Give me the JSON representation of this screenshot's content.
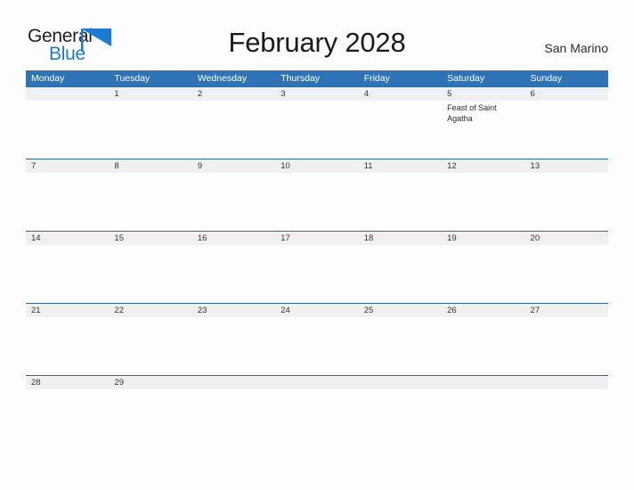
{
  "brand": {
    "name_part1": "General",
    "name_part2": "Blue",
    "flag_icon": "blue-flag-triangle",
    "color_dark": "#231f20",
    "color_blue": "#1b7ad1"
  },
  "header": {
    "title": "February 2028",
    "locale": "San Marino"
  },
  "theme": {
    "header_blue": "#2e73b5",
    "row_line_blue": "#2e6da4",
    "daynum_band_gray": "#f0f0f0",
    "page_background": "#fdfdfd"
  },
  "calendar": {
    "month": "February",
    "year": "2028",
    "weekday_headers": [
      "Monday",
      "Tuesday",
      "Wednesday",
      "Thursday",
      "Friday",
      "Saturday",
      "Sunday"
    ],
    "weeks": [
      {
        "days": [
          {
            "num": "",
            "event": ""
          },
          {
            "num": "1",
            "event": ""
          },
          {
            "num": "2",
            "event": ""
          },
          {
            "num": "3",
            "event": ""
          },
          {
            "num": "4",
            "event": ""
          },
          {
            "num": "5",
            "event": "Feast of Saint Agatha"
          },
          {
            "num": "6",
            "event": ""
          }
        ]
      },
      {
        "days": [
          {
            "num": "7",
            "event": ""
          },
          {
            "num": "8",
            "event": ""
          },
          {
            "num": "9",
            "event": ""
          },
          {
            "num": "10",
            "event": ""
          },
          {
            "num": "11",
            "event": ""
          },
          {
            "num": "12",
            "event": ""
          },
          {
            "num": "13",
            "event": ""
          }
        ]
      },
      {
        "days": [
          {
            "num": "14",
            "event": ""
          },
          {
            "num": "15",
            "event": ""
          },
          {
            "num": "16",
            "event": ""
          },
          {
            "num": "17",
            "event": ""
          },
          {
            "num": "18",
            "event": ""
          },
          {
            "num": "19",
            "event": ""
          },
          {
            "num": "20",
            "event": ""
          }
        ]
      },
      {
        "days": [
          {
            "num": "21",
            "event": ""
          },
          {
            "num": "22",
            "event": ""
          },
          {
            "num": "23",
            "event": ""
          },
          {
            "num": "24",
            "event": ""
          },
          {
            "num": "25",
            "event": ""
          },
          {
            "num": "26",
            "event": ""
          },
          {
            "num": "27",
            "event": ""
          }
        ]
      },
      {
        "days": [
          {
            "num": "28",
            "event": ""
          },
          {
            "num": "29",
            "event": ""
          },
          {
            "num": "",
            "event": ""
          },
          {
            "num": "",
            "event": ""
          },
          {
            "num": "",
            "event": ""
          },
          {
            "num": "",
            "event": ""
          },
          {
            "num": "",
            "event": ""
          }
        ]
      }
    ]
  }
}
